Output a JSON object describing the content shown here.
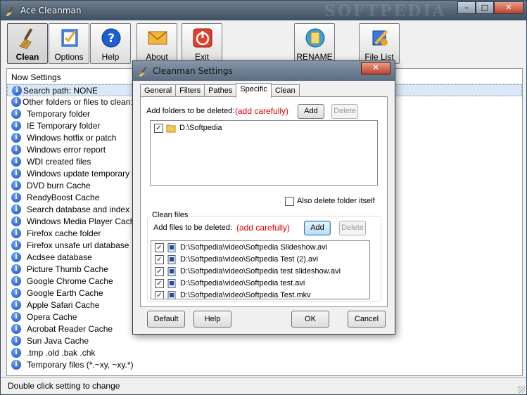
{
  "window": {
    "title": "Ace Cleanman",
    "watermark": "SOFTPEDIA",
    "minimize_label": "–",
    "maximize_label": "□",
    "close_label": "✕"
  },
  "toolbar": {
    "clean": "Clean",
    "options": "Options",
    "help": "Help",
    "about": "About",
    "exit": "Exit",
    "rename": "RENAME",
    "file_list": "File List"
  },
  "list": {
    "header": "Now Settings",
    "search_path": "Search path:  NONE",
    "other_folders": "Other folders or files to clean:",
    "items": [
      "Temporary folder",
      "IE Temporary folder",
      "Windows hotfix or patch",
      "Windows error report",
      "WDI created files",
      "Windows update temporary file",
      "DVD burn Cache",
      "ReadyBoost  Cache",
      "Search database and index",
      "Windows Media Player Cache",
      "Firefox cache folder",
      "Firefox unsafe url database",
      "Acdsee database",
      "Picture Thumb Cache",
      "Google Chrome Cache",
      "Google Earth Cache",
      "Apple Safari Cache",
      "Opera Cache",
      "Acrobat Reader Cache",
      "Sun Java Cache",
      ".tmp .old .bak .chk",
      "Temporary files (*.~xy, ~xy.*)"
    ]
  },
  "status": {
    "text": "Double click setting to change"
  },
  "dialog": {
    "title": "Cleanman Settings",
    "close_label": "✕",
    "tabs": [
      "General",
      "Filters",
      "Pathes",
      "Specific",
      "Clean"
    ],
    "active_tab": "Specific",
    "folders": {
      "label": "Add folders to be deleted:",
      "warning": "(add carefully)",
      "add": "Add",
      "delete": "Delete",
      "items": [
        {
          "path": "D:\\Softpedia",
          "checked": true
        }
      ],
      "also_delete_folder": "Also delete folder itself",
      "also_delete_checked": false
    },
    "files": {
      "group_title": "Clean files",
      "label": "Add files to be deleted:",
      "warning": "(add carefully)",
      "add": "Add",
      "delete": "Delete",
      "items": [
        {
          "path": "D:\\Softpedia\\video\\Softpedia Slideshow.avi",
          "checked": true
        },
        {
          "path": "D:\\Softpedia\\video\\Softpedia Test (2).avi",
          "checked": true
        },
        {
          "path": "D:\\Softpedia\\video\\Softpedia test slideshow.avi",
          "checked": true
        },
        {
          "path": "D:\\Softpedia\\video\\Softpedia test.avi",
          "checked": true
        },
        {
          "path": "D:\\Softpedia\\video\\Softpedia Test.mkv",
          "checked": true
        }
      ]
    },
    "buttons": {
      "default": "Default",
      "help": "Help",
      "ok": "OK",
      "cancel": "Cancel"
    }
  },
  "colors": {
    "warning_red": "#e00000",
    "info_blue": "#1a48b8",
    "selection": "#dce8f6"
  }
}
